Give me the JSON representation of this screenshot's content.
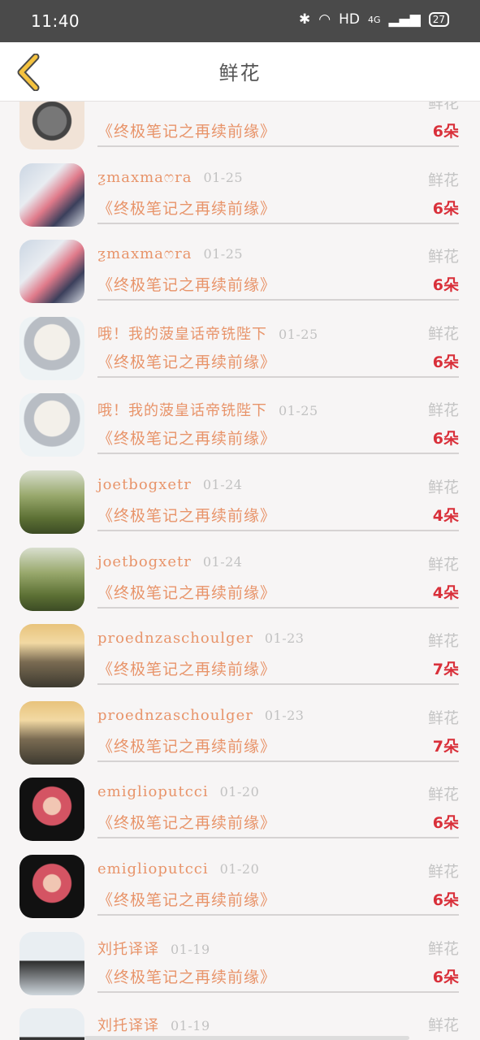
{
  "status": {
    "time": "11:40",
    "network": "HD",
    "signal": "4G",
    "battery": "27"
  },
  "header": {
    "title": "鲜花"
  },
  "colors": {
    "accent": "#e8946a",
    "count": "#d9303a",
    "muted": "#c4c4c4"
  },
  "rows": [
    {
      "avatar": "watch",
      "name": "",
      "date": "",
      "book": "《终极笔记之再续前缘》",
      "label": "鲜花",
      "count": "6朵"
    },
    {
      "avatar": "couple",
      "name": "ƺmaxmaෆra",
      "date": "01-25",
      "book": "《终极笔记之再续前缘》",
      "label": "鲜花",
      "count": "6朵"
    },
    {
      "avatar": "couple",
      "name": "ƺmaxmaෆra",
      "date": "01-25",
      "book": "《终极笔记之再续前缘》",
      "label": "鲜花",
      "count": "6朵"
    },
    {
      "avatar": "cat",
      "name": "哦！我的菠皇话帝铣陛下",
      "date": "01-25",
      "book": "《终极笔记之再续前缘》",
      "label": "鲜花",
      "count": "6朵"
    },
    {
      "avatar": "cat",
      "name": "哦！我的菠皇话帝铣陛下",
      "date": "01-25",
      "book": "《终极笔记之再续前缘》",
      "label": "鲜花",
      "count": "6朵"
    },
    {
      "avatar": "flowers",
      "name": "joetbogxetr",
      "date": "01-24",
      "book": "《终极笔记之再续前缘》",
      "label": "鲜花",
      "count": "4朵"
    },
    {
      "avatar": "flowers",
      "name": "joetbogxetr",
      "date": "01-24",
      "book": "《终极笔记之再续前缘》",
      "label": "鲜花",
      "count": "4朵"
    },
    {
      "avatar": "road",
      "name": "proednzaschoulger",
      "date": "01-23",
      "book": "《终极笔记之再续前缘》",
      "label": "鲜花",
      "count": "7朵"
    },
    {
      "avatar": "road",
      "name": "proednzaschoulger",
      "date": "01-23",
      "book": "《终极笔记之再续前缘》",
      "label": "鲜花",
      "count": "7朵"
    },
    {
      "avatar": "girl",
      "name": "emiglioputcci",
      "date": "01-20",
      "book": "《终极笔记之再续前缘》",
      "label": "鲜花",
      "count": "6朵"
    },
    {
      "avatar": "girl",
      "name": "emiglioputcci",
      "date": "01-20",
      "book": "《终极笔记之再续前缘》",
      "label": "鲜花",
      "count": "6朵"
    },
    {
      "avatar": "boy",
      "name": "刘托译译",
      "date": "01-19",
      "book": "《终极笔记之再续前缘》",
      "label": "鲜花",
      "count": "6朵"
    },
    {
      "avatar": "boy",
      "name": "刘托译译",
      "date": "01-19",
      "book": "",
      "label": "鲜花",
      "count": ""
    }
  ]
}
